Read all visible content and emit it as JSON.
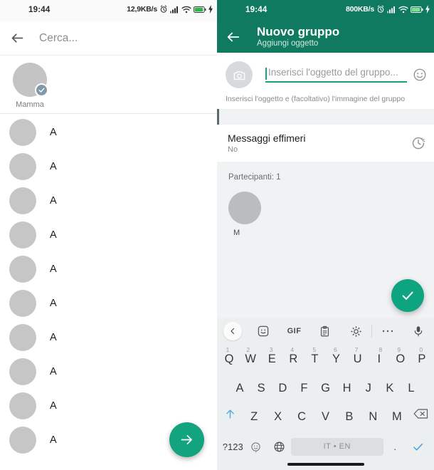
{
  "left_screen": {
    "statusbar": {
      "time": "19:44",
      "network_speed": "12,9KB/s",
      "icons": [
        "alarm-icon",
        "signal-icon",
        "wifi-icon",
        "battery-icon",
        "charging-icon"
      ]
    },
    "search": {
      "back_icon": "back-arrow-icon",
      "placeholder": "Cerca..."
    },
    "selected_chips": [
      {
        "label": "Mamma",
        "badge": "check-badge"
      }
    ],
    "contacts": [
      {
        "name": "A"
      },
      {
        "name": "A"
      },
      {
        "name": "A"
      },
      {
        "name": "A"
      },
      {
        "name": "A"
      },
      {
        "name": "A"
      },
      {
        "name": "A"
      },
      {
        "name": "A"
      },
      {
        "name": "A"
      },
      {
        "name": "A"
      }
    ],
    "fab": {
      "icon": "arrow-right-icon",
      "color": "#14a37f"
    }
  },
  "right_screen": {
    "statusbar": {
      "time": "19:44",
      "network_speed": "800KB/s",
      "icons": [
        "alarm-icon",
        "signal-icon",
        "wifi-icon",
        "battery-icon",
        "charging-icon"
      ]
    },
    "appbar": {
      "back_icon": "back-arrow-icon",
      "title": "Nuovo gruppo",
      "subtitle": "Aggiungi oggetto",
      "color": "#0f7a5f"
    },
    "subject": {
      "camera_icon": "camera-icon",
      "placeholder": "Inserisci l'oggetto del gruppo...",
      "value": "",
      "emoji_icon": "emoji-smile-icon",
      "hint": "Inserisci l'oggetto e (facoltativo) l'immagine del gruppo"
    },
    "ephemeral": {
      "title": "Messaggi effimeri",
      "value": "No",
      "icon": "timer-icon"
    },
    "participants": {
      "label": "Partecipanti: 1",
      "members": [
        {
          "name": "M"
        }
      ]
    },
    "fab": {
      "icon": "check-icon",
      "color": "#0ea47f"
    },
    "keyboard": {
      "toolbar": [
        {
          "name": "back",
          "icon": "chevron-left-icon",
          "label": ""
        },
        {
          "name": "sticker",
          "icon": "sticker-face-icon",
          "label": ""
        },
        {
          "name": "gif",
          "icon": "gif-icon",
          "label": "GIF"
        },
        {
          "name": "clipboard",
          "icon": "clipboard-icon",
          "label": ""
        },
        {
          "name": "settings",
          "icon": "gear-icon",
          "label": ""
        },
        {
          "name": "more",
          "icon": "more-dots-icon",
          "label": ""
        },
        {
          "name": "mic",
          "icon": "microphone-icon",
          "label": ""
        }
      ],
      "row1": [
        {
          "key": "Q",
          "num": "1"
        },
        {
          "key": "W",
          "num": "2"
        },
        {
          "key": "E",
          "num": "3"
        },
        {
          "key": "R",
          "num": "4"
        },
        {
          "key": "T",
          "num": "5"
        },
        {
          "key": "Y",
          "num": "6"
        },
        {
          "key": "U",
          "num": "7"
        },
        {
          "key": "I",
          "num": "8"
        },
        {
          "key": "O",
          "num": "9"
        },
        {
          "key": "P",
          "num": "0"
        }
      ],
      "row2": [
        {
          "key": "A"
        },
        {
          "key": "S"
        },
        {
          "key": "D"
        },
        {
          "key": "F"
        },
        {
          "key": "G"
        },
        {
          "key": "H"
        },
        {
          "key": "J"
        },
        {
          "key": "K"
        },
        {
          "key": "L"
        }
      ],
      "row3": [
        {
          "key": "Z"
        },
        {
          "key": "X"
        },
        {
          "key": "C"
        },
        {
          "key": "V"
        },
        {
          "key": "B"
        },
        {
          "key": "N"
        },
        {
          "key": "M"
        }
      ],
      "shift_icon": "shift-up-arrow-icon",
      "backspace_icon": "backspace-icon",
      "row4": {
        "symbols_label": "?123",
        "emoji_icon": "emoji-comma-icon",
        "comma_label": ",",
        "language_icon": "globe-icon",
        "space_label": "IT • EN",
        "period_label": ".",
        "enter_icon": "check-icon"
      }
    }
  }
}
